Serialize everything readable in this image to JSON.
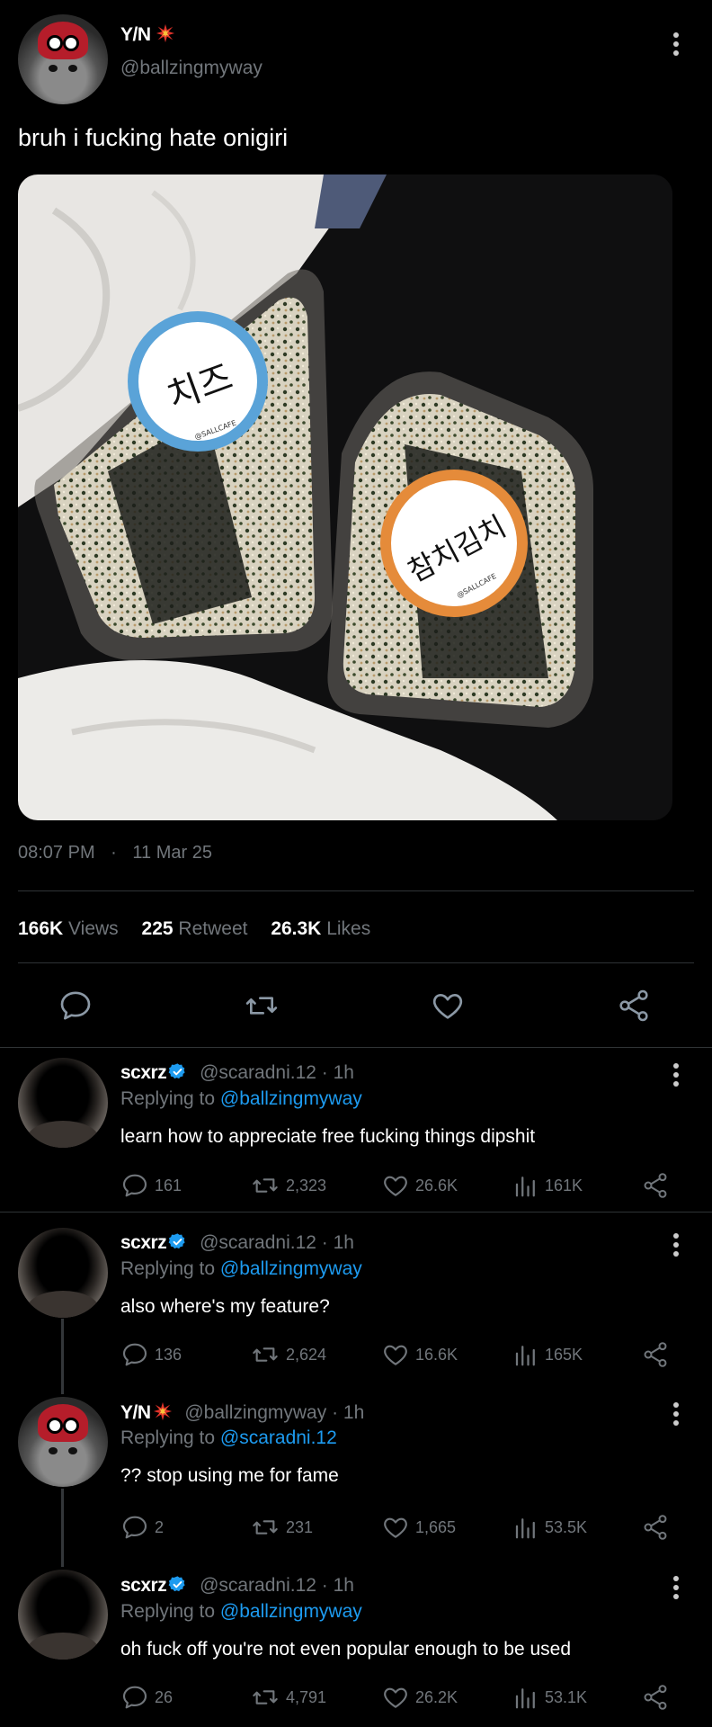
{
  "main_tweet": {
    "author_name": "Y/N",
    "author_handle": "@ballzingmyway",
    "text": "bruh i fucking hate onigiri",
    "image": {
      "label_left": "치즈",
      "label_right": "참치김치",
      "sticker_brand": "@SALLCAFE"
    },
    "time": "08:07 PM",
    "date_separator": "·",
    "date": "11 Mar 25",
    "stats": {
      "views_count": "166K",
      "views_label": "Views",
      "retweets_count": "225",
      "retweets_label": "Retweet",
      "likes_count": "26.3K",
      "likes_label": "Likes"
    }
  },
  "replies": [
    {
      "name": "scxrz",
      "handle": "@scaradni.12",
      "time": "· 1h",
      "replying_prefix": "Replying to",
      "replying_handle": "@ballzingmyway",
      "text": "learn how to appreciate free fucking things dipshit",
      "comments": "161",
      "retweets": "2,323",
      "likes": "26.6K",
      "views": "161K"
    },
    {
      "name": "scxrz",
      "handle": "@scaradni.12",
      "time": "· 1h",
      "replying_prefix": "Replying to",
      "replying_handle": "@ballzingmyway",
      "text": "also where's my feature?",
      "comments": "136",
      "retweets": "2,624",
      "likes": "16.6K",
      "views": "165K"
    },
    {
      "name": "Y/N",
      "handle": "@ballzingmyway",
      "time": "· 1h",
      "replying_prefix": "Replying to",
      "replying_handle": "@scaradni.12",
      "text": "?? stop using me for fame",
      "comments": "2",
      "retweets": "231",
      "likes": "1,665",
      "views": "53.5K"
    },
    {
      "name": "scxrz",
      "handle": "@scaradni.12",
      "time": "· 1h",
      "replying_prefix": "Replying to",
      "replying_handle": "@ballzingmyway",
      "text": "oh fuck off you're not even popular enough to be used",
      "comments": "26",
      "retweets": "4,791",
      "likes": "26.2K",
      "views": "53.1K"
    }
  ],
  "colors": {
    "background": "#000000",
    "link": "#1d9bf0",
    "muted": "#71767b",
    "verified": "#1d9bf0",
    "divider": "#2f3336"
  },
  "icons": [
    "more-icon",
    "comment-icon",
    "retweet-icon",
    "like-icon",
    "views-icon",
    "share-icon",
    "verified-icon",
    "explosion-icon"
  ]
}
